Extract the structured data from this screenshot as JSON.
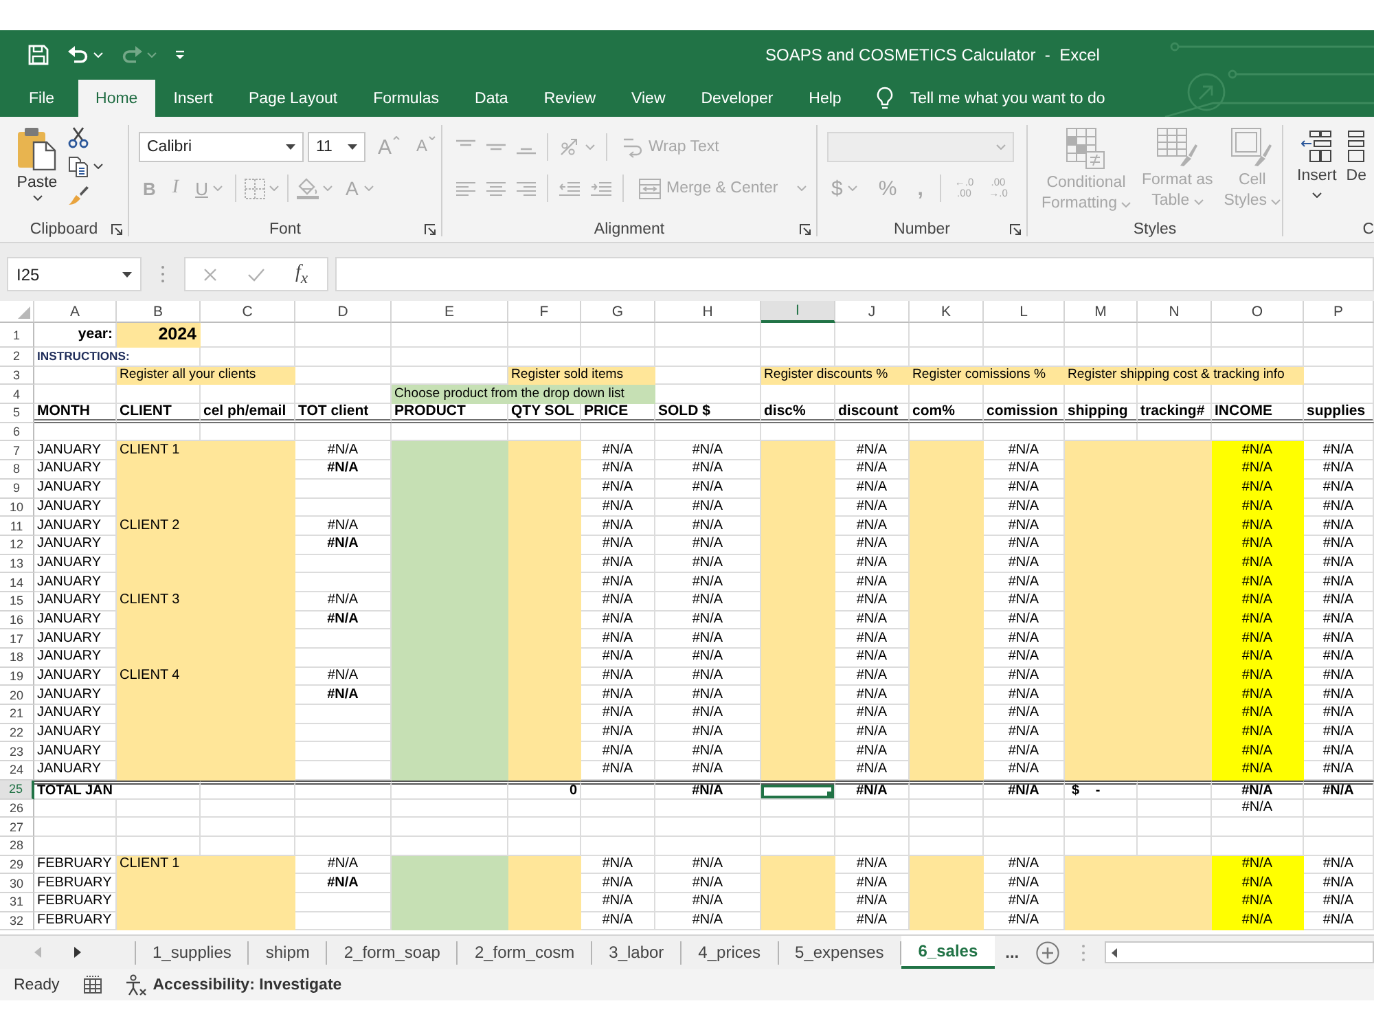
{
  "title_bar": {
    "title": "SOAPS and COSMETICS Calculator  -  Excel"
  },
  "quick_access": [
    {
      "kind": "save",
      "disabled": false
    },
    {
      "kind": "undo",
      "disabled": false
    },
    {
      "kind": "redo",
      "disabled": true
    },
    {
      "kind": "customize",
      "disabled": false
    }
  ],
  "ribbon_tabs": [
    {
      "label": "File",
      "selected": false
    },
    {
      "label": "Home",
      "selected": true
    },
    {
      "label": "Insert",
      "selected": false
    },
    {
      "label": "Page Layout",
      "selected": false
    },
    {
      "label": "Formulas",
      "selected": false
    },
    {
      "label": "Data",
      "selected": false
    },
    {
      "label": "Review",
      "selected": false
    },
    {
      "label": "View",
      "selected": false
    },
    {
      "label": "Developer",
      "selected": false
    },
    {
      "label": "Help",
      "selected": false
    }
  ],
  "tell_me": {
    "placeholder": "Tell me what you want to do"
  },
  "ribbon": {
    "clipboard": {
      "label": "Clipboard",
      "paste": {
        "label": "Paste",
        "disabled": false
      },
      "tools": [
        {
          "kind": "cut",
          "disabled": false
        },
        {
          "kind": "copy",
          "disabled": false
        },
        {
          "kind": "format_painter",
          "disabled": false
        }
      ]
    },
    "font": {
      "label": "Font",
      "font_name": "Calibri",
      "font_size": "11",
      "top": [
        {
          "kind": "grow",
          "label": "A",
          "disabled": true
        },
        {
          "kind": "shrink",
          "label": "A",
          "disabled": true
        }
      ],
      "bottom": [
        {
          "kind": "bold",
          "label": "B",
          "disabled": true
        },
        {
          "kind": "italic",
          "label": "I",
          "disabled": true
        },
        {
          "kind": "underline",
          "label": "U",
          "disabled": true
        },
        {
          "kind": "borders",
          "disabled": true
        },
        {
          "kind": "fill_color",
          "disabled": true
        },
        {
          "kind": "font_color",
          "label": "A",
          "disabled": true
        }
      ]
    },
    "alignment": {
      "label": "Alignment",
      "top": [
        {
          "kind": "align_top",
          "disabled": true
        },
        {
          "kind": "align_middle",
          "disabled": true
        },
        {
          "kind": "align_bottom",
          "disabled": true
        },
        {
          "kind": "orientation",
          "disabled": true
        },
        {
          "kind": "wrap",
          "label": "Wrap Text",
          "disabled": true
        }
      ],
      "bottom": [
        {
          "kind": "align_left",
          "disabled": true
        },
        {
          "kind": "align_center",
          "disabled": true
        },
        {
          "kind": "align_right",
          "disabled": true
        },
        {
          "kind": "indent_less",
          "disabled": true
        },
        {
          "kind": "indent_more",
          "disabled": true
        },
        {
          "kind": "merge",
          "label": "Merge & Center",
          "disabled": true
        }
      ]
    },
    "number": {
      "label": "Number",
      "format": {
        "disabled": true
      },
      "buttons": [
        {
          "kind": "currency",
          "label": "$",
          "disabled": true
        },
        {
          "kind": "percent",
          "label": "%",
          "disabled": true
        },
        {
          "kind": "comma",
          "label": ",",
          "disabled": true
        },
        {
          "kind": "decimal_more",
          "lines": [
            "←.0",
            ".00"
          ],
          "disabled": true
        },
        {
          "kind": "decimal_less",
          "lines": [
            ".00",
            "→.0"
          ],
          "disabled": true
        }
      ]
    },
    "styles": {
      "label": "Styles",
      "buttons": [
        {
          "kind": "conditional",
          "lines": [
            "Conditional",
            "Formatting"
          ],
          "disabled": true
        },
        {
          "kind": "table",
          "lines": [
            "Format as",
            "Table"
          ],
          "disabled": true
        },
        {
          "kind": "cell_styles",
          "lines": [
            "Cell",
            "Styles"
          ],
          "disabled": true
        }
      ]
    },
    "cells": {
      "label": "C",
      "buttons": [
        {
          "kind": "insert",
          "label": "Insert",
          "disabled": false
        },
        {
          "kind": "delete",
          "label": "De",
          "disabled": false
        }
      ]
    }
  },
  "formula_bar": {
    "name_box": "I25",
    "buttons": [
      {
        "kind": "cancel",
        "disabled": true
      },
      {
        "kind": "enter",
        "disabled": true
      }
    ],
    "insert_function": "f$_{x}$"
  },
  "sheet": {
    "columns": [
      {
        "letter": "A",
        "kind": "month",
        "selected": false
      },
      {
        "letter": "B",
        "kind": "client",
        "selected": false
      },
      {
        "letter": "C",
        "kind": "client",
        "selected": false
      },
      {
        "letter": "D",
        "kind": "calc",
        "selected": false
      },
      {
        "letter": "E",
        "kind": "product",
        "selected": false
      },
      {
        "letter": "F",
        "kind": "entry",
        "selected": false
      },
      {
        "letter": "G",
        "kind": "calc",
        "selected": false
      },
      {
        "letter": "H",
        "kind": "calc",
        "selected": false
      },
      {
        "letter": "I",
        "kind": "entry",
        "selected": true
      },
      {
        "letter": "J",
        "kind": "calc",
        "selected": false
      },
      {
        "letter": "K",
        "kind": "entry",
        "selected": false
      },
      {
        "letter": "L",
        "kind": "calc",
        "selected": false
      },
      {
        "letter": "M",
        "kind": "entry",
        "selected": false
      },
      {
        "letter": "N",
        "kind": "entry",
        "selected": false
      },
      {
        "letter": "O",
        "kind": "income",
        "selected": false
      },
      {
        "letter": "P",
        "kind": "calc",
        "selected": false
      }
    ],
    "rows": [
      {
        "number": "1",
        "kind": "year",
        "selected": false,
        "cells": [
          {
            "text": "year:",
            "kind": "label"
          },
          {
            "text": "2024",
            "kind": "year"
          }
        ]
      },
      {
        "number": "2",
        "kind": "note",
        "selected": false,
        "cells": [
          {
            "text": "INSTRUCTIONS:",
            "kind": "instructions"
          },
          {
            "merge": true
          }
        ]
      },
      {
        "number": "3",
        "kind": "note",
        "selected": false,
        "cells": [
          null,
          {
            "text": "Register all your clients",
            "kind": "note_input"
          },
          {
            "merge": true
          },
          null,
          null,
          {
            "text": "Register sold items",
            "kind": "note_input"
          },
          {
            "merge": true
          },
          null,
          {
            "text": "Register discounts %",
            "kind": "note_input"
          },
          {
            "merge": true
          },
          {
            "text": "Register comissions %",
            "kind": "note_input"
          },
          {
            "merge": true
          },
          {
            "text": "Register shipping cost & tracking info",
            "kind": "note_input"
          },
          {
            "merge": true
          },
          {
            "merge": true
          }
        ]
      },
      {
        "number": "4",
        "kind": "note",
        "selected": false,
        "cells": [
          null,
          null,
          null,
          null,
          {
            "text": "Choose product from the drop down list",
            "kind": "note_product"
          },
          {
            "merge": true
          },
          {
            "merge": true
          }
        ]
      },
      {
        "number": "5",
        "kind": "header",
        "selected": false,
        "cells": [
          "MONTH",
          "CLIENT",
          "cel ph/email",
          "TOT client",
          "PRODUCT",
          "QTY SOL",
          "PRICE",
          "SOLD $",
          "disc%",
          "discount",
          "com%",
          "comission",
          "shipping",
          "tracking#",
          "INCOME",
          "supplies"
        ]
      },
      {
        "number": "6",
        "kind": "plain",
        "selected": false
      },
      {
        "number": "7",
        "kind": "data",
        "selected": false,
        "cells": [
          "JANUARY",
          "CLIENT 1",
          null,
          "#N/A",
          null,
          null,
          "#N/A",
          "#N/A",
          null,
          "#N/A",
          null,
          "#N/A",
          null,
          null,
          "#N/A",
          "#N/A"
        ]
      },
      {
        "number": "8",
        "kind": "data",
        "selected": false,
        "cells": [
          "JANUARY",
          null,
          null,
          {
            "text": "#N/A",
            "kind": "subtotal"
          },
          null,
          null,
          "#N/A",
          "#N/A",
          null,
          "#N/A",
          null,
          "#N/A",
          null,
          null,
          "#N/A",
          "#N/A"
        ]
      },
      {
        "number": "9",
        "kind": "data",
        "selected": false,
        "cells": [
          "JANUARY",
          null,
          null,
          null,
          null,
          null,
          "#N/A",
          "#N/A",
          null,
          "#N/A",
          null,
          "#N/A",
          null,
          null,
          "#N/A",
          "#N/A"
        ]
      },
      {
        "number": "10",
        "kind": "data",
        "selected": false,
        "cells": [
          "JANUARY",
          null,
          null,
          null,
          null,
          null,
          "#N/A",
          "#N/A",
          null,
          "#N/A",
          null,
          "#N/A",
          null,
          null,
          "#N/A",
          "#N/A"
        ]
      },
      {
        "number": "11",
        "kind": "data",
        "selected": false,
        "cells": [
          "JANUARY",
          "CLIENT 2",
          null,
          "#N/A",
          null,
          null,
          "#N/A",
          "#N/A",
          null,
          "#N/A",
          null,
          "#N/A",
          null,
          null,
          "#N/A",
          "#N/A"
        ]
      },
      {
        "number": "12",
        "kind": "data",
        "selected": false,
        "cells": [
          "JANUARY",
          null,
          null,
          {
            "text": "#N/A",
            "kind": "subtotal"
          },
          null,
          null,
          "#N/A",
          "#N/A",
          null,
          "#N/A",
          null,
          "#N/A",
          null,
          null,
          "#N/A",
          "#N/A"
        ]
      },
      {
        "number": "13",
        "kind": "data",
        "selected": false,
        "cells": [
          "JANUARY",
          null,
          null,
          null,
          null,
          null,
          "#N/A",
          "#N/A",
          null,
          "#N/A",
          null,
          "#N/A",
          null,
          null,
          "#N/A",
          "#N/A"
        ]
      },
      {
        "number": "14",
        "kind": "data",
        "selected": false,
        "cells": [
          "JANUARY",
          null,
          null,
          null,
          null,
          null,
          "#N/A",
          "#N/A",
          null,
          "#N/A",
          null,
          "#N/A",
          null,
          null,
          "#N/A",
          "#N/A"
        ]
      },
      {
        "number": "15",
        "kind": "data",
        "selected": false,
        "cells": [
          "JANUARY",
          "CLIENT 3",
          null,
          "#N/A",
          null,
          null,
          "#N/A",
          "#N/A",
          null,
          "#N/A",
          null,
          "#N/A",
          null,
          null,
          "#N/A",
          "#N/A"
        ]
      },
      {
        "number": "16",
        "kind": "data",
        "selected": false,
        "cells": [
          "JANUARY",
          null,
          null,
          {
            "text": "#N/A",
            "kind": "subtotal"
          },
          null,
          null,
          "#N/A",
          "#N/A",
          null,
          "#N/A",
          null,
          "#N/A",
          null,
          null,
          "#N/A",
          "#N/A"
        ]
      },
      {
        "number": "17",
        "kind": "data",
        "selected": false,
        "cells": [
          "JANUARY",
          null,
          null,
          null,
          null,
          null,
          "#N/A",
          "#N/A",
          null,
          "#N/A",
          null,
          "#N/A",
          null,
          null,
          "#N/A",
          "#N/A"
        ]
      },
      {
        "number": "18",
        "kind": "data",
        "selected": false,
        "cells": [
          "JANUARY",
          null,
          null,
          null,
          null,
          null,
          "#N/A",
          "#N/A",
          null,
          "#N/A",
          null,
          "#N/A",
          null,
          null,
          "#N/A",
          "#N/A"
        ]
      },
      {
        "number": "19",
        "kind": "data",
        "selected": false,
        "cells": [
          "JANUARY",
          "CLIENT 4",
          null,
          "#N/A",
          null,
          null,
          "#N/A",
          "#N/A",
          null,
          "#N/A",
          null,
          "#N/A",
          null,
          null,
          "#N/A",
          "#N/A"
        ]
      },
      {
        "number": "20",
        "kind": "data",
        "selected": false,
        "cells": [
          "JANUARY",
          null,
          null,
          {
            "text": "#N/A",
            "kind": "subtotal"
          },
          null,
          null,
          "#N/A",
          "#N/A",
          null,
          "#N/A",
          null,
          "#N/A",
          null,
          null,
          "#N/A",
          "#N/A"
        ]
      },
      {
        "number": "21",
        "kind": "data",
        "selected": false,
        "cells": [
          "JANUARY",
          null,
          null,
          null,
          null,
          null,
          "#N/A",
          "#N/A",
          null,
          "#N/A",
          null,
          "#N/A",
          null,
          null,
          "#N/A",
          "#N/A"
        ]
      },
      {
        "number": "22",
        "kind": "data",
        "selected": false,
        "cells": [
          "JANUARY",
          null,
          null,
          null,
          null,
          null,
          "#N/A",
          "#N/A",
          null,
          "#N/A",
          null,
          "#N/A",
          null,
          null,
          "#N/A",
          "#N/A"
        ]
      },
      {
        "number": "23",
        "kind": "data",
        "selected": false,
        "cells": [
          "JANUARY",
          null,
          null,
          null,
          null,
          null,
          "#N/A",
          "#N/A",
          null,
          "#N/A",
          null,
          "#N/A",
          null,
          null,
          "#N/A",
          "#N/A"
        ]
      },
      {
        "number": "24",
        "kind": "data",
        "selected": false,
        "cells": [
          "JANUARY",
          null,
          null,
          null,
          null,
          null,
          "#N/A",
          "#N/A",
          null,
          "#N/A",
          null,
          "#N/A",
          null,
          null,
          "#N/A",
          "#N/A"
        ]
      },
      {
        "number": "25",
        "kind": "total",
        "selected": true,
        "cells": [
          "TOTAL JAN",
          {
            "merge": true
          },
          null,
          null,
          null,
          {
            "text": "0",
            "kind": "number"
          },
          null,
          "#N/A",
          null,
          "#N/A",
          null,
          "#N/A",
          {
            "text": "$ -",
            "kind": "currency"
          },
          null,
          "#N/A",
          "#N/A"
        ]
      },
      {
        "number": "26",
        "kind": "plain",
        "selected": false,
        "cells": [
          null,
          null,
          null,
          null,
          null,
          null,
          null,
          null,
          null,
          null,
          null,
          null,
          null,
          null,
          "#N/A"
        ]
      },
      {
        "number": "27",
        "kind": "plain",
        "selected": false
      },
      {
        "number": "28",
        "kind": "plain",
        "selected": false
      },
      {
        "number": "29",
        "kind": "data",
        "selected": false,
        "cells": [
          "FEBRUARY",
          "CLIENT 1",
          null,
          "#N/A",
          null,
          null,
          "#N/A",
          "#N/A",
          null,
          "#N/A",
          null,
          "#N/A",
          null,
          null,
          "#N/A",
          "#N/A"
        ]
      },
      {
        "number": "30",
        "kind": "data",
        "selected": false,
        "cells": [
          "FEBRUARY",
          null,
          null,
          {
            "text": "#N/A",
            "kind": "subtotal"
          },
          null,
          null,
          "#N/A",
          "#N/A",
          null,
          "#N/A",
          null,
          "#N/A",
          null,
          null,
          "#N/A",
          "#N/A"
        ]
      },
      {
        "number": "31",
        "kind": "data",
        "selected": false,
        "cells": [
          "FEBRUARY",
          null,
          null,
          null,
          null,
          null,
          "#N/A",
          "#N/A",
          null,
          "#N/A",
          null,
          "#N/A",
          null,
          null,
          "#N/A",
          "#N/A"
        ]
      },
      {
        "number": "32",
        "kind": "data",
        "selected": false,
        "cells": [
          "FEBRUARY",
          null,
          null,
          null,
          null,
          null,
          "#N/A",
          "#N/A",
          null,
          "#N/A",
          null,
          "#N/A",
          null,
          null,
          "#N/A",
          "#N/A"
        ]
      }
    ]
  },
  "sheet_tabs": {
    "nav": [
      {
        "kind": "previous",
        "disabled": true
      },
      {
        "kind": "next",
        "disabled": false
      }
    ],
    "tabs": [
      {
        "label": "1_supplies",
        "selected": false
      },
      {
        "label": "shipm",
        "selected": false
      },
      {
        "label": "2_form_soap",
        "selected": false
      },
      {
        "label": "2_form_cosm",
        "selected": false
      },
      {
        "label": "3_labor",
        "selected": false
      },
      {
        "label": "4_prices",
        "selected": false
      },
      {
        "label": "5_expenses",
        "selected": false
      },
      {
        "label": "6_sales",
        "selected": true
      }
    ],
    "more": "..."
  },
  "status_bar": {
    "mode": "Ready",
    "accessibility": "Accessibility: Investigate"
  }
}
